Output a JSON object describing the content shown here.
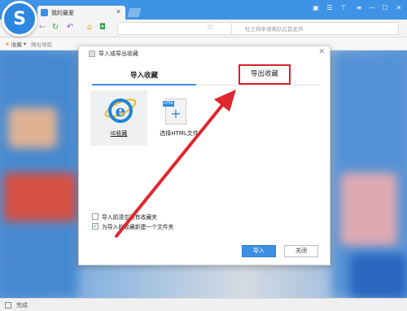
{
  "browser": {
    "tab_title": "我的最爱",
    "logo_letter": "S",
    "search_placeholder": "杜兰特申请离队后首发声",
    "bookmarks_label": "收藏",
    "bookmark_item": "网址导航"
  },
  "dialog": {
    "title": "导入或导出收藏",
    "tabs": {
      "import": "导入收藏",
      "export": "导出收藏"
    },
    "sources": {
      "ie": "IE收藏",
      "html_tag": "HTML",
      "html_file": "选择HTML文件"
    },
    "options": {
      "clear_before": "导入前清空现有收藏夹",
      "new_folder": "为导入的收藏新建一个文件夹"
    },
    "buttons": {
      "import": "导入",
      "close": "关闭"
    }
  },
  "status": {
    "text": "完成"
  },
  "colors": {
    "accent": "#3b8fe4",
    "highlight": "#d8222a",
    "arrow": "#e0262e"
  }
}
